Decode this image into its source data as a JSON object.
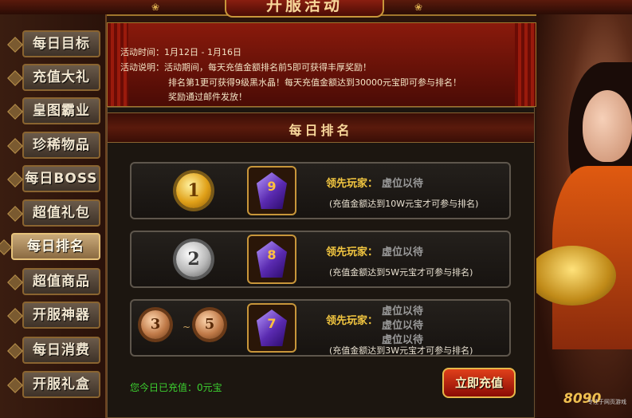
{
  "header": {
    "title": "开服活动"
  },
  "sidebar": {
    "items": [
      {
        "label": "每日目标",
        "active": false
      },
      {
        "label": "充值大礼",
        "active": false
      },
      {
        "label": "皇图霸业",
        "active": false
      },
      {
        "label": "珍稀物品",
        "active": false
      },
      {
        "label": "每日BOSS",
        "active": false
      },
      {
        "label": "超值礼包",
        "active": false
      },
      {
        "label": "每日排名",
        "active": true
      },
      {
        "label": "超值商品",
        "active": false
      },
      {
        "label": "开服神器",
        "active": false
      },
      {
        "label": "每日消费",
        "active": false
      },
      {
        "label": "开服礼盒",
        "active": false
      }
    ]
  },
  "banner": {
    "time_label": "活动时间：",
    "time_value": "1月12日 - 1月16日",
    "desc_label": "活动说明：",
    "desc_line1": "活动期间，每天充值金额排名前5即可获得丰厚奖励！",
    "desc_line2": "排名第1更可获得9级黑水晶！每天充值金额达到30000元宝即可参与排名！",
    "desc_line3": "奖励通过邮件发放！"
  },
  "section": {
    "title": "每日排名"
  },
  "ranks": [
    {
      "medal": "1",
      "gem_level": "9",
      "leader_label": "领先玩家：",
      "leaders": [
        "虚位以待"
      ],
      "condition": "(充值金额达到10W元宝才可参与排名)"
    },
    {
      "medal": "2",
      "gem_level": "8",
      "leader_label": "领先玩家：",
      "leaders": [
        "虚位以待"
      ],
      "condition": "(充值金额达到5W元宝才可参与排名)"
    },
    {
      "medal": "3",
      "medal_to": "5",
      "range_sep": "~",
      "gem_level": "7",
      "leader_label": "领先玩家：",
      "leaders": [
        "虚位以待",
        "虚位以待",
        "虚位以待"
      ],
      "condition": "(充值金额达到3W元宝才可参与排名)"
    }
  ],
  "footer": {
    "today_recharge": "您今日已充值：0元宝",
    "recharge_button": "立即充值"
  },
  "brand": {
    "logo": "8090",
    "logo_sub": "专注于网页游戏"
  },
  "colors": {
    "accent_gold": "#f2c640",
    "today_green": "#3cd030",
    "banner_red": "#8a1a0c"
  }
}
